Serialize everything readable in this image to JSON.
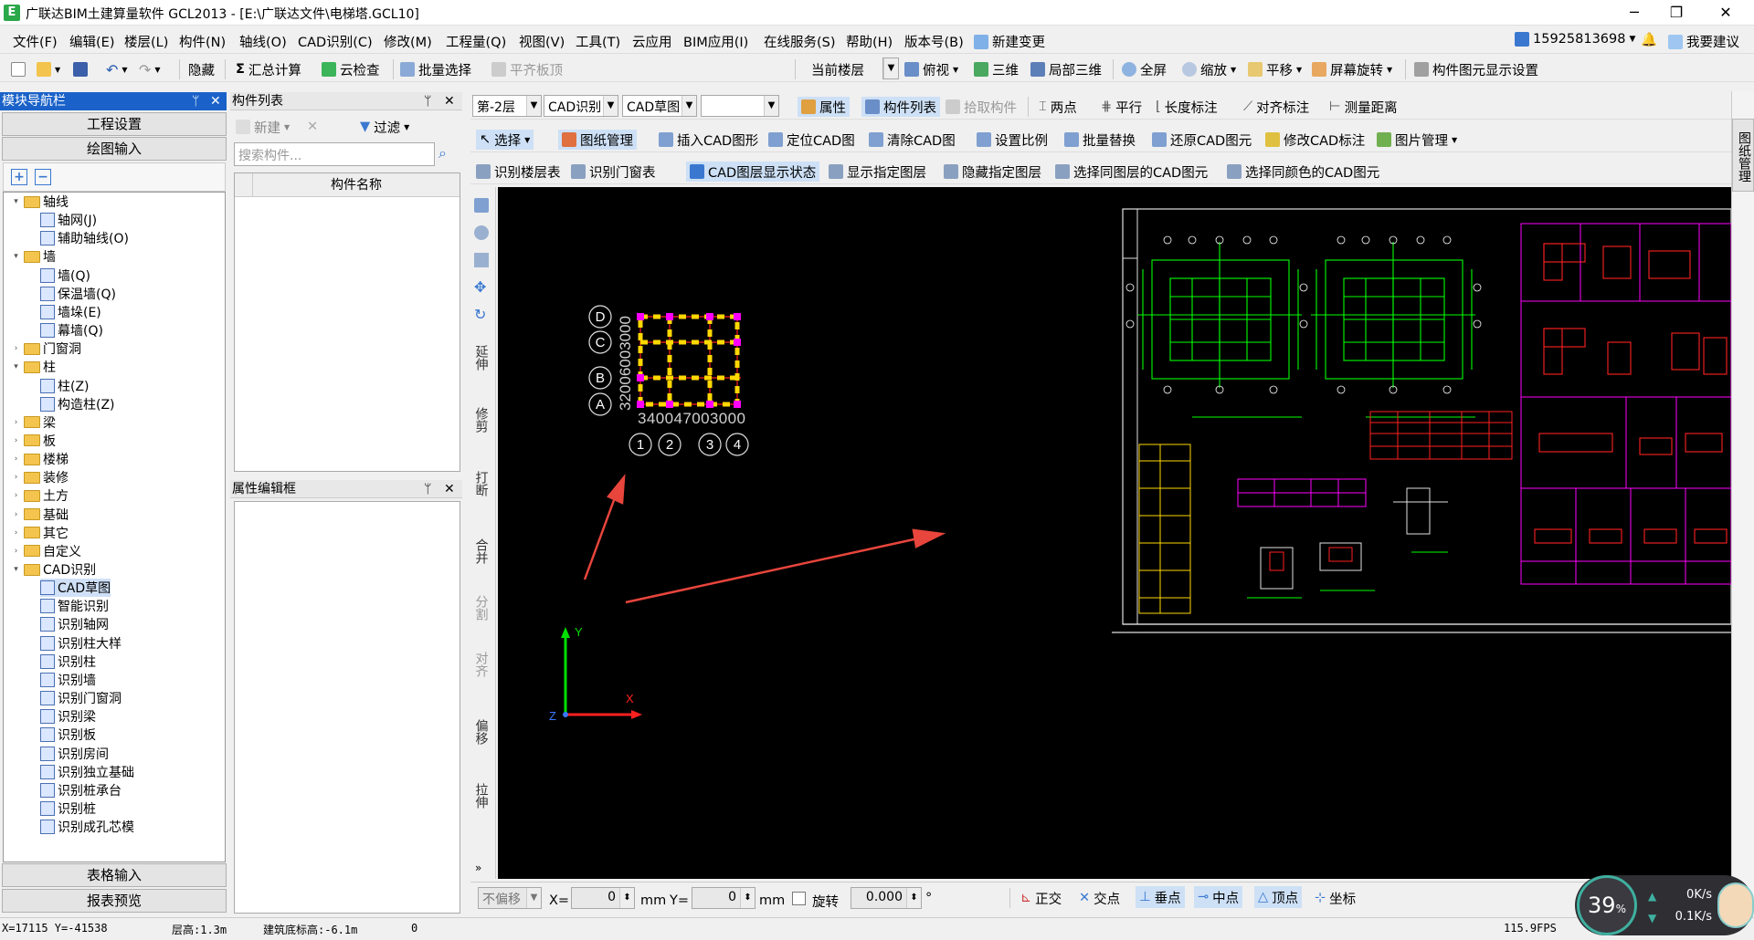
{
  "window": {
    "logo": "E",
    "title": "广联达BIM土建算量软件 GCL2013 - [E:\\广联达文件\\电梯塔.GCL10]",
    "min": "─",
    "max": "❐",
    "close": "✕"
  },
  "menu": [
    "文件(F)",
    "编辑(E)",
    "楼层(L)",
    "构件(N)",
    "轴线(O)",
    "CAD识别(C)",
    "修改(M)",
    "工程量(Q)",
    "视图(V)",
    "工具(T)",
    "云应用",
    "BIM应用(I)",
    "在线服务(S)",
    "帮助(H)",
    "版本号(B)"
  ],
  "menu_right": {
    "new_change": "新建变更",
    "phone": "15925813698",
    "suggest": "我要建议"
  },
  "toolbar1": {
    "hide": "隐藏",
    "calc": "汇总计算",
    "cloud_check": "云检查",
    "batch_select": "批量选择",
    "flat_top": "平齐板顶",
    "current_floor": "当前楼层",
    "top_view": "俯视",
    "three_d": "三维",
    "partial_3d": "局部三维",
    "full_screen": "全屏",
    "zoom": "缩放",
    "pan": "平移",
    "screen_rotate": "屏幕旋转",
    "display_settings": "构件图元显示设置"
  },
  "toolbar2": {
    "floor": "第-2层",
    "cad_recog": "CAD识别",
    "cad_draft": "CAD草图",
    "empty": "",
    "props": "属性",
    "comp_list": "构件列表",
    "pick": "拾取构件",
    "two_point": "两点",
    "parallel": "平行",
    "length_mark": "长度标注",
    "align_mark": "对齐标注",
    "measure": "测量距离"
  },
  "toolbar3": {
    "select": "选择",
    "drawing_mgmt": "图纸管理",
    "insert_cad": "插入CAD图形",
    "locate_cad": "定位CAD图",
    "clear_cad": "清除CAD图",
    "set_scale": "设置比例",
    "batch_replace": "批量替换",
    "restore_cad": "还原CAD图元",
    "modify_cad_mark": "修改CAD标注",
    "image_mgmt": "图片管理"
  },
  "toolbar4": {
    "recog_floor_table": "识别楼层表",
    "recog_door_table": "识别门窗表",
    "cad_layer_state": "CAD图层显示状态",
    "show_layer": "显示指定图层",
    "hide_layer": "隐藏指定图层",
    "select_same_layer": "选择同图层的CAD图元",
    "select_same_color": "选择同颜色的CAD图元"
  },
  "nav": {
    "header": "模块导航栏",
    "pin": "ᛘ",
    "close": "✕",
    "project_settings": "工程设置",
    "drawing_input": "绘图输入",
    "plus": "+",
    "minus": "−",
    "table_input": "表格输入",
    "report_preview": "报表预览"
  },
  "tree": [
    {
      "label": "轴线",
      "level": 0,
      "type": "folder",
      "exp": "▾"
    },
    {
      "label": "轴网(J)",
      "level": 1,
      "type": "leaf"
    },
    {
      "label": "辅助轴线(O)",
      "level": 1,
      "type": "leaf"
    },
    {
      "label": "墙",
      "level": 0,
      "type": "folder",
      "exp": "▾"
    },
    {
      "label": "墙(Q)",
      "level": 1,
      "type": "leaf"
    },
    {
      "label": "保温墙(Q)",
      "level": 1,
      "type": "leaf"
    },
    {
      "label": "墙垛(E)",
      "level": 1,
      "type": "leaf"
    },
    {
      "label": "幕墙(Q)",
      "level": 1,
      "type": "leaf"
    },
    {
      "label": "门窗洞",
      "level": 0,
      "type": "folder",
      "exp": "›"
    },
    {
      "label": "柱",
      "level": 0,
      "type": "folder",
      "exp": "▾"
    },
    {
      "label": "柱(Z)",
      "level": 1,
      "type": "leaf"
    },
    {
      "label": "构造柱(Z)",
      "level": 1,
      "type": "leaf"
    },
    {
      "label": "梁",
      "level": 0,
      "type": "folder",
      "exp": "›"
    },
    {
      "label": "板",
      "level": 0,
      "type": "folder",
      "exp": "›"
    },
    {
      "label": "楼梯",
      "level": 0,
      "type": "folder",
      "exp": "›"
    },
    {
      "label": "装修",
      "level": 0,
      "type": "folder",
      "exp": "›"
    },
    {
      "label": "土方",
      "level": 0,
      "type": "folder",
      "exp": "›"
    },
    {
      "label": "基础",
      "level": 0,
      "type": "folder",
      "exp": "›"
    },
    {
      "label": "其它",
      "level": 0,
      "type": "folder",
      "exp": "›"
    },
    {
      "label": "自定义",
      "level": 0,
      "type": "folder",
      "exp": "›"
    },
    {
      "label": "CAD识别",
      "level": 0,
      "type": "folder",
      "exp": "▾"
    },
    {
      "label": "CAD草图",
      "level": 1,
      "type": "leaf",
      "selected": true
    },
    {
      "label": "智能识别",
      "level": 1,
      "type": "leaf"
    },
    {
      "label": "识别轴网",
      "level": 1,
      "type": "leaf"
    },
    {
      "label": "识别柱大样",
      "level": 1,
      "type": "leaf"
    },
    {
      "label": "识别柱",
      "level": 1,
      "type": "leaf"
    },
    {
      "label": "识别墙",
      "level": 1,
      "type": "leaf"
    },
    {
      "label": "识别门窗洞",
      "level": 1,
      "type": "leaf"
    },
    {
      "label": "识别梁",
      "level": 1,
      "type": "leaf"
    },
    {
      "label": "识别板",
      "level": 1,
      "type": "leaf"
    },
    {
      "label": "识别房间",
      "level": 1,
      "type": "leaf"
    },
    {
      "label": "识别独立基础",
      "level": 1,
      "type": "leaf"
    },
    {
      "label": "识别桩承台",
      "level": 1,
      "type": "leaf"
    },
    {
      "label": "识别桩",
      "level": 1,
      "type": "leaf"
    },
    {
      "label": "识别成孔芯模",
      "level": 1,
      "type": "leaf"
    }
  ],
  "complist": {
    "header": "构件列表",
    "new": "新建",
    "delete": "✕",
    "filter": "过滤",
    "search_placeholder": "搜索构件...",
    "col_name": "构件名称"
  },
  "propedit": {
    "header": "属性编辑框"
  },
  "vtools": [
    "延伸",
    "修剪",
    "打断",
    "合并",
    "分割",
    "对齐",
    "偏移",
    "拉伸"
  ],
  "right_tab": "图纸管理",
  "axes": {
    "rows": [
      "D",
      "C",
      "B",
      "A"
    ],
    "row_dims": "32006003000",
    "cols": [
      "1",
      "2",
      "3",
      "4"
    ],
    "col_dims": "340047003000",
    "y": "Y",
    "x": "X",
    "z": "Z"
  },
  "snapbar": {
    "no_offset": "不偏移",
    "x_label": "X=",
    "x_val": "0",
    "mm1": "mm",
    "y_label": "Y=",
    "y_val": "0",
    "mm2": "mm",
    "rotate": "旋转",
    "rotate_val": "0.000",
    "deg": "°",
    "ortho": "正交",
    "intersect": "交点",
    "perp": "垂点",
    "mid": "中点",
    "vertex": "顶点",
    "coord": "坐标"
  },
  "status": {
    "coords": "X=17115 Y=-41538",
    "floor_h": "层高:1.3m",
    "base_elev": "建筑底标高:-6.1m",
    "zero": "0",
    "fps": "115.9FPS"
  },
  "net": {
    "percent": "39",
    "unit": "%",
    "up": "0K/s",
    "down": "0.1K/s"
  },
  "colors": {
    "accent": "#1a62c9",
    "cad_green": "#00ff00",
    "cad_magenta": "#ff00ff",
    "cad_red": "#ff2020",
    "arrow": "#e8453c"
  }
}
